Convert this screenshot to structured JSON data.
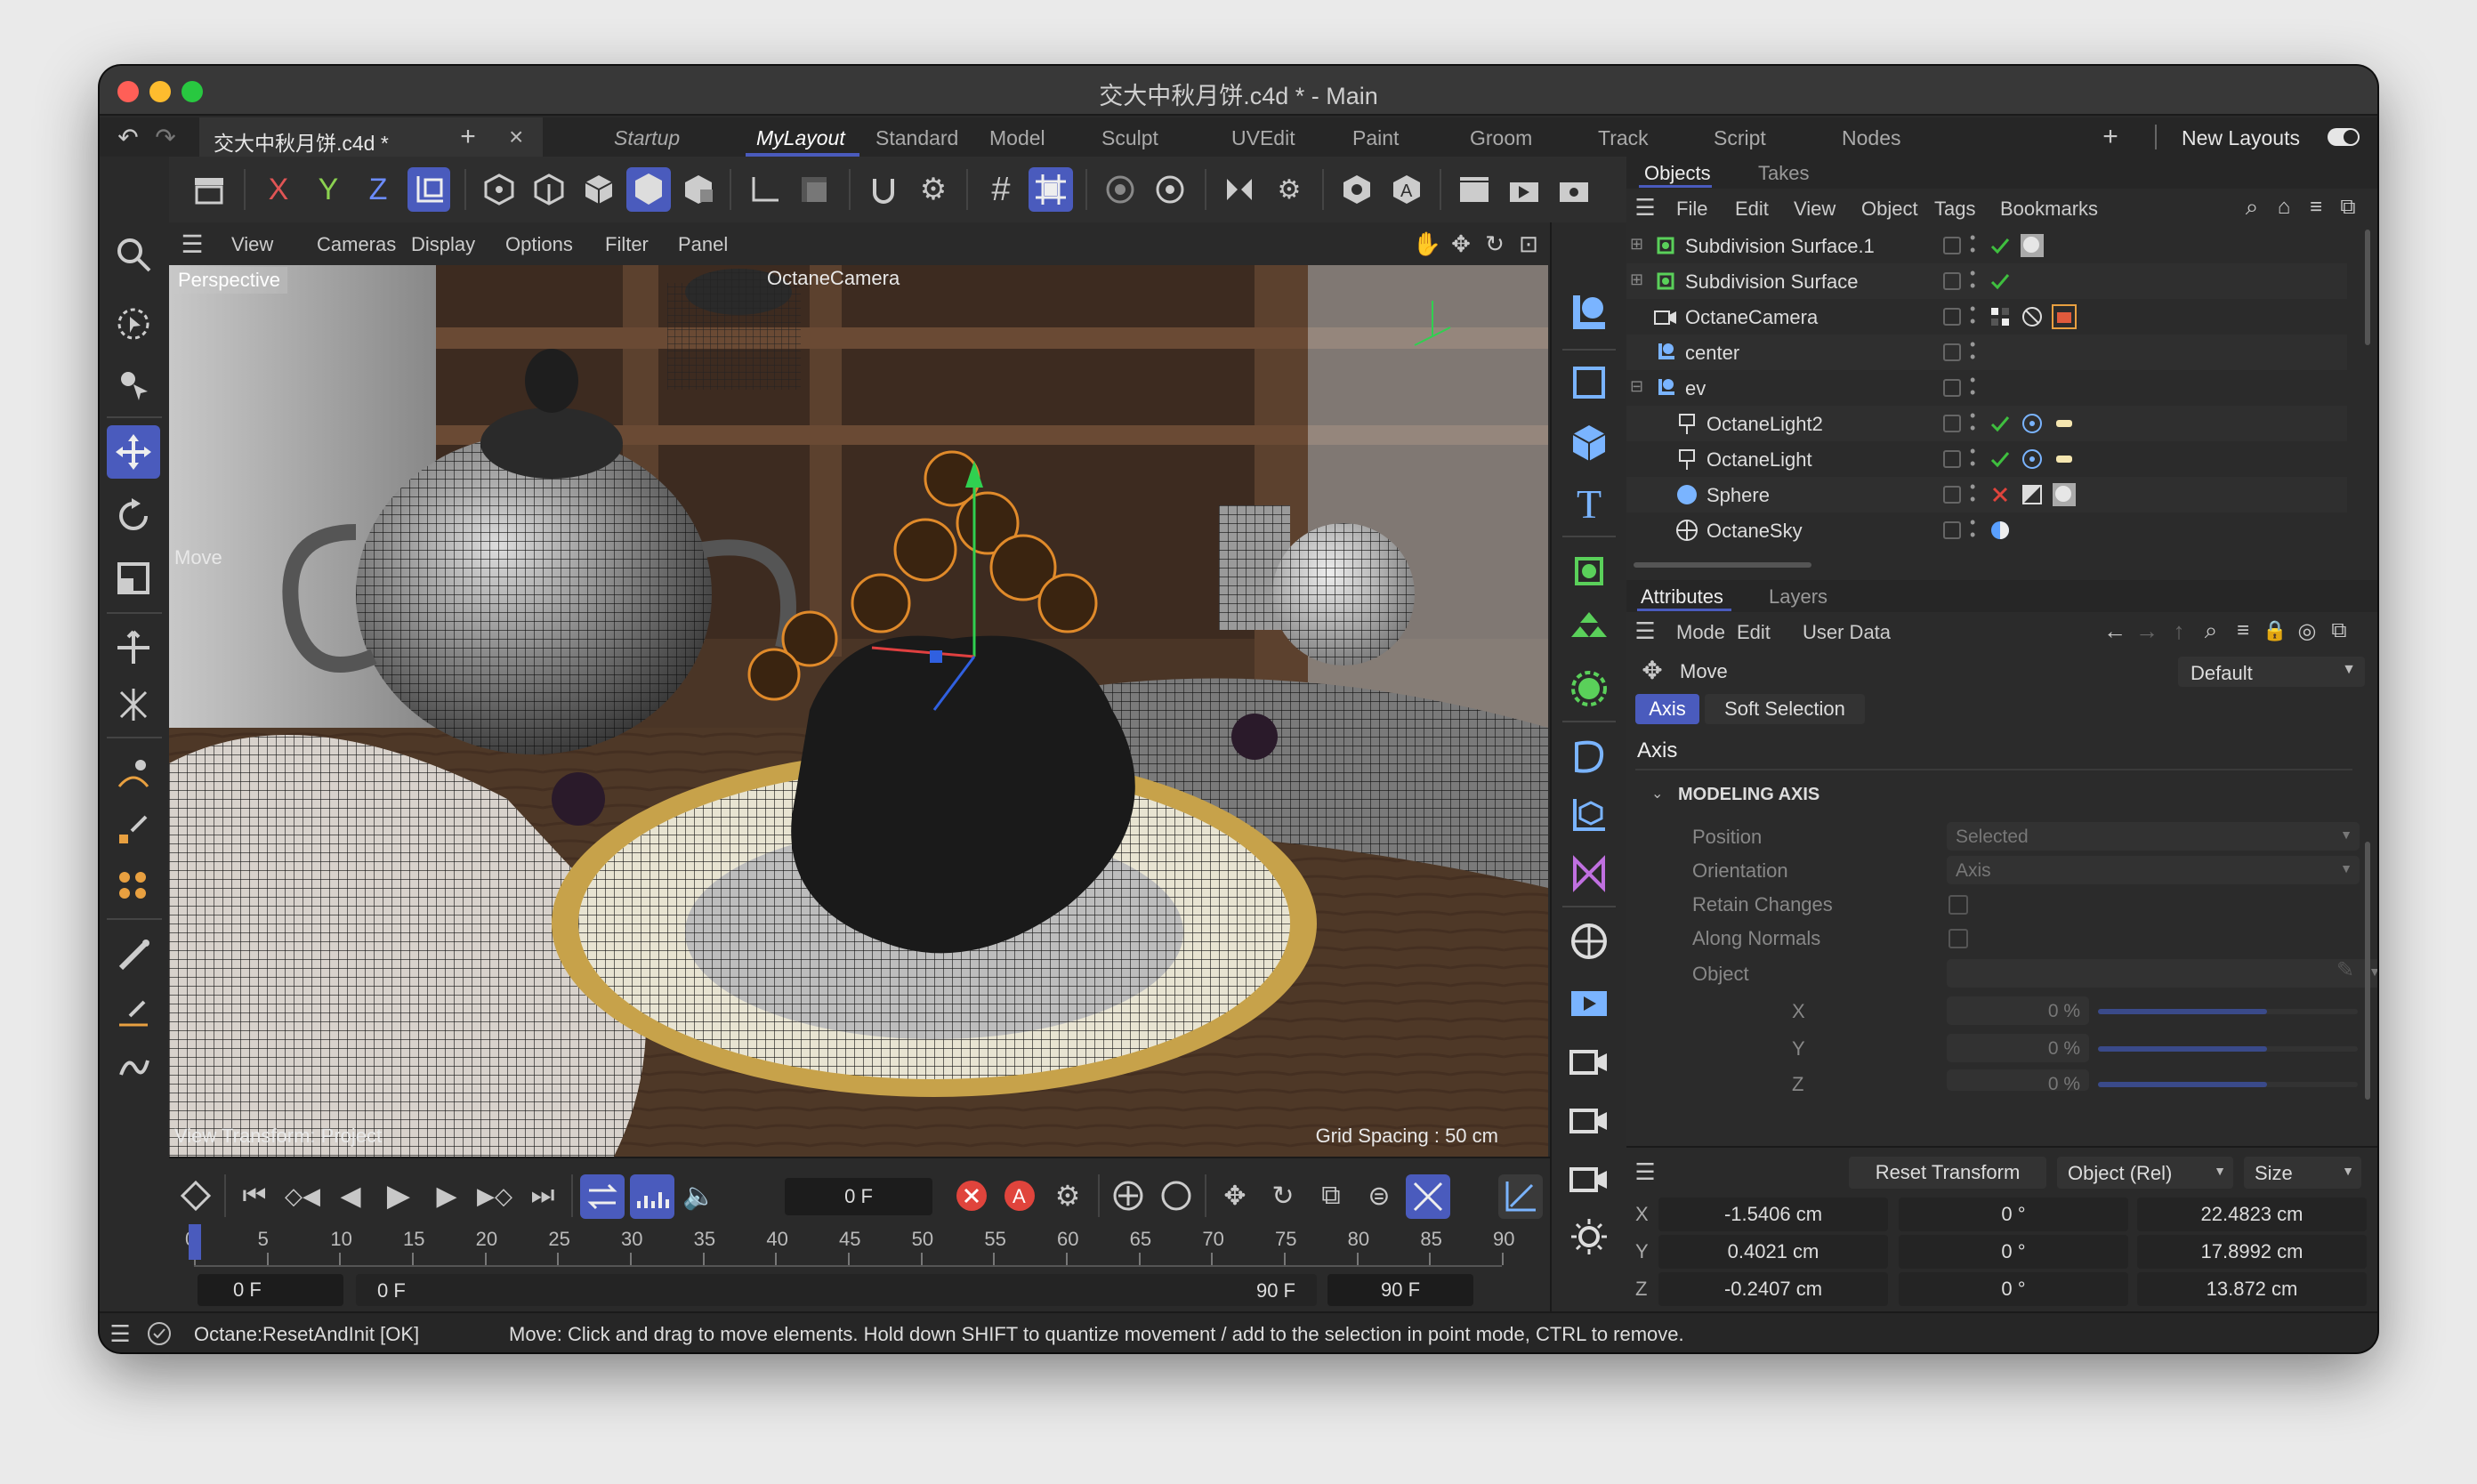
{
  "window": {
    "title": "交大中秋月饼.c4d * - Main"
  },
  "doc_tab": {
    "label": "交大中秋月饼.c4d *"
  },
  "layouts": [
    "Startup",
    "MyLayout",
    "Standard",
    "Model",
    "Sculpt",
    "UVEdit",
    "Paint",
    "Groom",
    "Track",
    "Script",
    "Nodes"
  ],
  "active_layout": "MyLayout",
  "new_layouts_label": "New Layouts",
  "axis_lock": {
    "x": "X",
    "y": "Y",
    "z": "Z"
  },
  "viewport_menu": [
    "View",
    "Cameras",
    "Display",
    "Options",
    "Filter",
    "Panel"
  ],
  "viewport": {
    "projection": "Perspective",
    "camera": "OctaneCamera",
    "tool": "Move",
    "view_transform": "View Transform: Project",
    "grid_spacing": "Grid Spacing : 50 cm"
  },
  "timeline": {
    "current_frame": "0 F",
    "ticks": [
      "0",
      "5",
      "10",
      "15",
      "20",
      "25",
      "30",
      "35",
      "40",
      "45",
      "50",
      "55",
      "60",
      "65",
      "70",
      "75",
      "80",
      "85",
      "90"
    ],
    "min": "0 F",
    "preview_start": "0 F",
    "preview_end": "90 F",
    "max": "90 F"
  },
  "objects_panel": {
    "tabs": [
      "Objects",
      "Takes"
    ],
    "menu": [
      "File",
      "Edit",
      "View",
      "Object",
      "Tags",
      "Bookmarks"
    ],
    "items": [
      {
        "name": "Subdivision Surface.1",
        "indent": 0
      },
      {
        "name": "Subdivision Surface",
        "indent": 0
      },
      {
        "name": "OctaneCamera",
        "indent": 0
      },
      {
        "name": "center",
        "indent": 0
      },
      {
        "name": "ev",
        "indent": 0
      },
      {
        "name": "OctaneLight2",
        "indent": 1
      },
      {
        "name": "OctaneLight",
        "indent": 1
      },
      {
        "name": "Sphere",
        "indent": 1
      },
      {
        "name": "OctaneSky",
        "indent": 1
      }
    ]
  },
  "attributes_panel": {
    "tabs": [
      "Attributes",
      "Layers"
    ],
    "menu": [
      "Mode",
      "Edit",
      "User Data"
    ],
    "tool_name": "Move",
    "preset": "Default",
    "subtabs": [
      "Axis",
      "Soft Selection"
    ],
    "section": "Axis",
    "group": "MODELING AXIS",
    "fields": {
      "position_label": "Position",
      "position_value": "Selected",
      "orientation_label": "Orientation",
      "orientation_value": "Axis",
      "retain_label": "Retain Changes",
      "along_label": "Along Normals",
      "object_label": "Object",
      "x_label": "X",
      "x_value": "0 %",
      "y_label": "Y",
      "y_value": "0 %",
      "z_label": "Z",
      "z_value": "0 %"
    }
  },
  "coordinates": {
    "reset": "Reset Transform",
    "mode": "Object (Rel)",
    "size_mode": "Size",
    "rows": [
      {
        "axis": "X",
        "pos": "-1.5406 cm",
        "rot": "0 °",
        "size": "22.4823 cm"
      },
      {
        "axis": "Y",
        "pos": "0.4021 cm",
        "rot": "0 °",
        "size": "17.8992 cm"
      },
      {
        "axis": "Z",
        "pos": "-0.2407 cm",
        "rot": "0 °",
        "size": "13.872 cm"
      }
    ]
  },
  "status": {
    "left": "Octane:ResetAndInit [OK]",
    "hint": "Move: Click and drag to move elements. Hold down SHIFT to quantize movement / add to the selection in point mode, CTRL to remove."
  },
  "colors": {
    "accent": "#4a5bbd",
    "window_bg": "#2a2a2a",
    "panel_bg": "#2b2b2b",
    "check_green": "#3fbf3f",
    "disabled_red": "#e0443c"
  },
  "icons": [
    "undo-icon",
    "redo-icon",
    "search-icon",
    "move-icon",
    "rotate-icon",
    "scale-icon",
    "camera-icon",
    "light-icon",
    "sky-icon",
    "sphere-icon",
    "play-icon",
    "record-icon",
    "checkmark-icon",
    "hamburger-icon"
  ]
}
